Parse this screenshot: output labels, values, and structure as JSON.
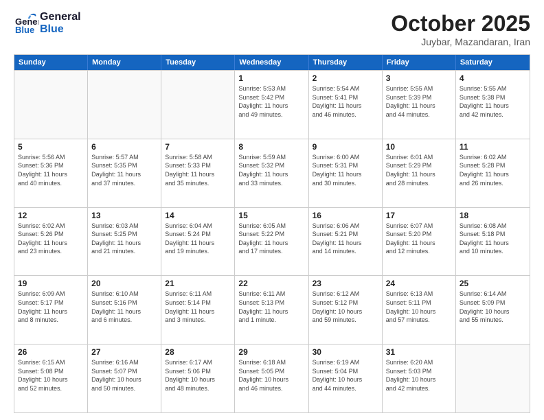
{
  "header": {
    "logo_general": "General",
    "logo_blue": "Blue",
    "month": "October 2025",
    "location": "Juybar, Mazandaran, Iran"
  },
  "weekdays": [
    "Sunday",
    "Monday",
    "Tuesday",
    "Wednesday",
    "Thursday",
    "Friday",
    "Saturday"
  ],
  "rows": [
    [
      {
        "day": "",
        "info": ""
      },
      {
        "day": "",
        "info": ""
      },
      {
        "day": "",
        "info": ""
      },
      {
        "day": "1",
        "info": "Sunrise: 5:53 AM\nSunset: 5:42 PM\nDaylight: 11 hours\nand 49 minutes."
      },
      {
        "day": "2",
        "info": "Sunrise: 5:54 AM\nSunset: 5:41 PM\nDaylight: 11 hours\nand 46 minutes."
      },
      {
        "day": "3",
        "info": "Sunrise: 5:55 AM\nSunset: 5:39 PM\nDaylight: 11 hours\nand 44 minutes."
      },
      {
        "day": "4",
        "info": "Sunrise: 5:55 AM\nSunset: 5:38 PM\nDaylight: 11 hours\nand 42 minutes."
      }
    ],
    [
      {
        "day": "5",
        "info": "Sunrise: 5:56 AM\nSunset: 5:36 PM\nDaylight: 11 hours\nand 40 minutes."
      },
      {
        "day": "6",
        "info": "Sunrise: 5:57 AM\nSunset: 5:35 PM\nDaylight: 11 hours\nand 37 minutes."
      },
      {
        "day": "7",
        "info": "Sunrise: 5:58 AM\nSunset: 5:33 PM\nDaylight: 11 hours\nand 35 minutes."
      },
      {
        "day": "8",
        "info": "Sunrise: 5:59 AM\nSunset: 5:32 PM\nDaylight: 11 hours\nand 33 minutes."
      },
      {
        "day": "9",
        "info": "Sunrise: 6:00 AM\nSunset: 5:31 PM\nDaylight: 11 hours\nand 30 minutes."
      },
      {
        "day": "10",
        "info": "Sunrise: 6:01 AM\nSunset: 5:29 PM\nDaylight: 11 hours\nand 28 minutes."
      },
      {
        "day": "11",
        "info": "Sunrise: 6:02 AM\nSunset: 5:28 PM\nDaylight: 11 hours\nand 26 minutes."
      }
    ],
    [
      {
        "day": "12",
        "info": "Sunrise: 6:02 AM\nSunset: 5:26 PM\nDaylight: 11 hours\nand 23 minutes."
      },
      {
        "day": "13",
        "info": "Sunrise: 6:03 AM\nSunset: 5:25 PM\nDaylight: 11 hours\nand 21 minutes."
      },
      {
        "day": "14",
        "info": "Sunrise: 6:04 AM\nSunset: 5:24 PM\nDaylight: 11 hours\nand 19 minutes."
      },
      {
        "day": "15",
        "info": "Sunrise: 6:05 AM\nSunset: 5:22 PM\nDaylight: 11 hours\nand 17 minutes."
      },
      {
        "day": "16",
        "info": "Sunrise: 6:06 AM\nSunset: 5:21 PM\nDaylight: 11 hours\nand 14 minutes."
      },
      {
        "day": "17",
        "info": "Sunrise: 6:07 AM\nSunset: 5:20 PM\nDaylight: 11 hours\nand 12 minutes."
      },
      {
        "day": "18",
        "info": "Sunrise: 6:08 AM\nSunset: 5:18 PM\nDaylight: 11 hours\nand 10 minutes."
      }
    ],
    [
      {
        "day": "19",
        "info": "Sunrise: 6:09 AM\nSunset: 5:17 PM\nDaylight: 11 hours\nand 8 minutes."
      },
      {
        "day": "20",
        "info": "Sunrise: 6:10 AM\nSunset: 5:16 PM\nDaylight: 11 hours\nand 6 minutes."
      },
      {
        "day": "21",
        "info": "Sunrise: 6:11 AM\nSunset: 5:14 PM\nDaylight: 11 hours\nand 3 minutes."
      },
      {
        "day": "22",
        "info": "Sunrise: 6:11 AM\nSunset: 5:13 PM\nDaylight: 11 hours\nand 1 minute."
      },
      {
        "day": "23",
        "info": "Sunrise: 6:12 AM\nSunset: 5:12 PM\nDaylight: 10 hours\nand 59 minutes."
      },
      {
        "day": "24",
        "info": "Sunrise: 6:13 AM\nSunset: 5:11 PM\nDaylight: 10 hours\nand 57 minutes."
      },
      {
        "day": "25",
        "info": "Sunrise: 6:14 AM\nSunset: 5:09 PM\nDaylight: 10 hours\nand 55 minutes."
      }
    ],
    [
      {
        "day": "26",
        "info": "Sunrise: 6:15 AM\nSunset: 5:08 PM\nDaylight: 10 hours\nand 52 minutes."
      },
      {
        "day": "27",
        "info": "Sunrise: 6:16 AM\nSunset: 5:07 PM\nDaylight: 10 hours\nand 50 minutes."
      },
      {
        "day": "28",
        "info": "Sunrise: 6:17 AM\nSunset: 5:06 PM\nDaylight: 10 hours\nand 48 minutes."
      },
      {
        "day": "29",
        "info": "Sunrise: 6:18 AM\nSunset: 5:05 PM\nDaylight: 10 hours\nand 46 minutes."
      },
      {
        "day": "30",
        "info": "Sunrise: 6:19 AM\nSunset: 5:04 PM\nDaylight: 10 hours\nand 44 minutes."
      },
      {
        "day": "31",
        "info": "Sunrise: 6:20 AM\nSunset: 5:03 PM\nDaylight: 10 hours\nand 42 minutes."
      },
      {
        "day": "",
        "info": ""
      }
    ]
  ]
}
